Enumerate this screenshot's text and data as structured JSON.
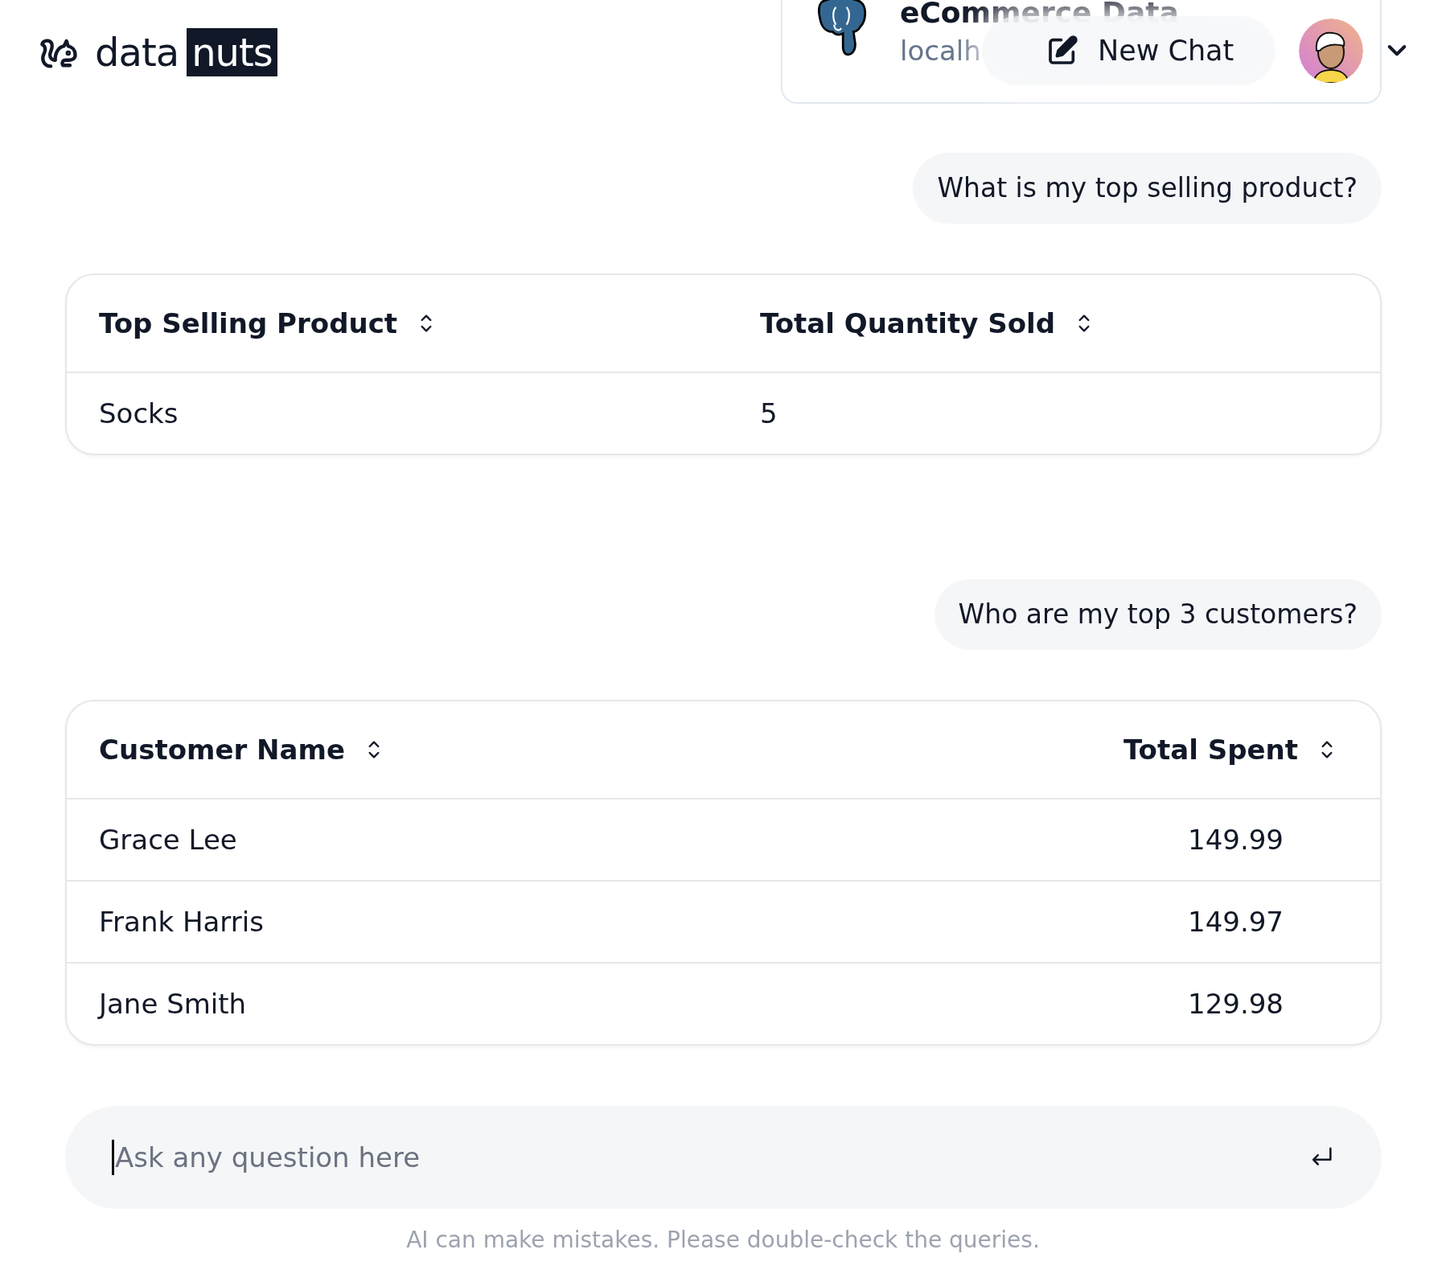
{
  "header": {
    "logo": {
      "word": "data",
      "highlight": "nuts"
    },
    "database": {
      "name": "eCommerce Data",
      "host": "localh"
    },
    "new_chat": "New Chat",
    "account_menu": {
      "expanded": false
    }
  },
  "conversation": [
    {
      "question": "What is my top selling product?",
      "table": {
        "columns": [
          {
            "label": "Top Selling Product",
            "kind": "text"
          },
          {
            "label": "Total Quantity Sold",
            "kind": "text"
          }
        ],
        "rows": [
          [
            "Socks",
            "5"
          ]
        ]
      }
    },
    {
      "question": "Who are my top 3 customers?",
      "table": {
        "columns": [
          {
            "label": "Customer Name",
            "kind": "text"
          },
          {
            "label": "Total Spent",
            "kind": "amount"
          }
        ],
        "rows": [
          [
            "Grace Lee",
            "149.99"
          ],
          [
            "Frank Harris",
            "149.97"
          ],
          [
            "Jane Smith",
            "129.98"
          ]
        ]
      }
    }
  ],
  "composer": {
    "placeholder": "Ask any question here"
  },
  "disclaimer": "AI can make mistakes. Please double-check the queries."
}
